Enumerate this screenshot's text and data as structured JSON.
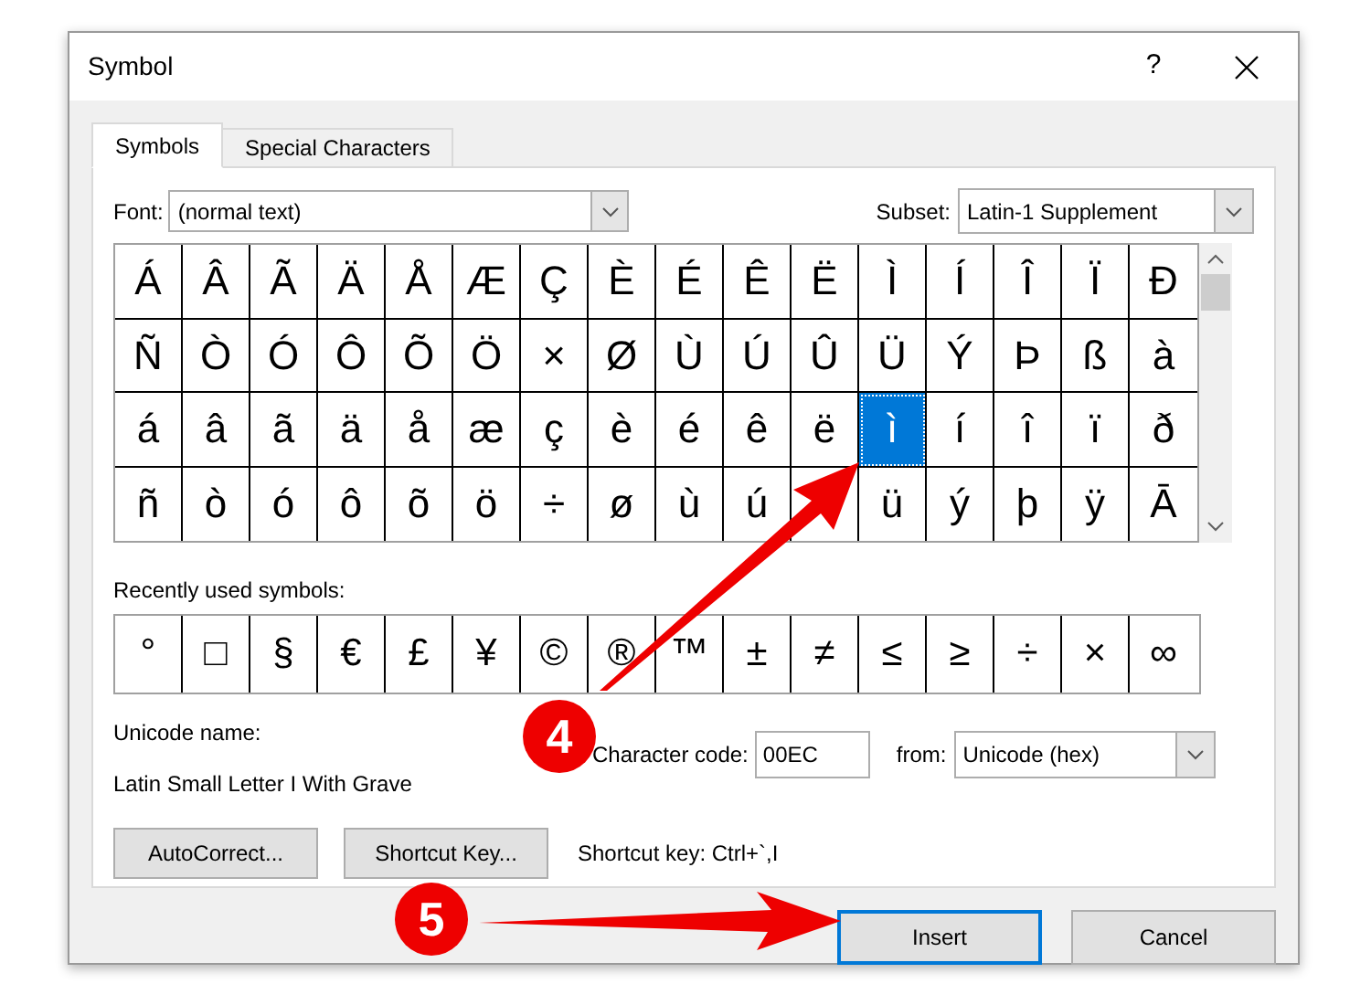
{
  "window": {
    "title": "Symbol",
    "help": "?"
  },
  "tabs": [
    {
      "label": "Symbols",
      "selected": true
    },
    {
      "label": "Special Characters",
      "selected": false
    }
  ],
  "font": {
    "label": "Font:",
    "value": "(normal text)"
  },
  "subset": {
    "label": "Subset:",
    "value": "Latin-1 Supplement"
  },
  "symbol_rows": [
    [
      {
        "char": "Á",
        "selected": false
      },
      {
        "char": "Â",
        "selected": false
      },
      {
        "char": "Ã",
        "selected": false
      },
      {
        "char": "Ä",
        "selected": false
      },
      {
        "char": "Å",
        "selected": false
      },
      {
        "char": "Æ",
        "selected": false
      },
      {
        "char": "Ç",
        "selected": false
      },
      {
        "char": "È",
        "selected": false
      },
      {
        "char": "É",
        "selected": false
      },
      {
        "char": "Ê",
        "selected": false
      },
      {
        "char": "Ë",
        "selected": false
      },
      {
        "char": "Ì",
        "selected": false
      },
      {
        "char": "Í",
        "selected": false
      },
      {
        "char": "Î",
        "selected": false
      },
      {
        "char": "Ï",
        "selected": false
      },
      {
        "char": "Ð",
        "selected": false
      }
    ],
    [
      {
        "char": "Ñ",
        "selected": false
      },
      {
        "char": "Ò",
        "selected": false
      },
      {
        "char": "Ó",
        "selected": false
      },
      {
        "char": "Ô",
        "selected": false
      },
      {
        "char": "Õ",
        "selected": false
      },
      {
        "char": "Ö",
        "selected": false
      },
      {
        "char": "×",
        "selected": false
      },
      {
        "char": "Ø",
        "selected": false
      },
      {
        "char": "Ù",
        "selected": false
      },
      {
        "char": "Ú",
        "selected": false
      },
      {
        "char": "Û",
        "selected": false
      },
      {
        "char": "Ü",
        "selected": false
      },
      {
        "char": "Ý",
        "selected": false
      },
      {
        "char": "Þ",
        "selected": false
      },
      {
        "char": "ß",
        "selected": false
      },
      {
        "char": "à",
        "selected": false
      }
    ],
    [
      {
        "char": "á",
        "selected": false
      },
      {
        "char": "â",
        "selected": false
      },
      {
        "char": "ã",
        "selected": false
      },
      {
        "char": "ä",
        "selected": false
      },
      {
        "char": "å",
        "selected": false
      },
      {
        "char": "æ",
        "selected": false
      },
      {
        "char": "ç",
        "selected": false
      },
      {
        "char": "è",
        "selected": false
      },
      {
        "char": "é",
        "selected": false
      },
      {
        "char": "ê",
        "selected": false
      },
      {
        "char": "ë",
        "selected": false
      },
      {
        "char": "ì",
        "selected": true
      },
      {
        "char": "í",
        "selected": false
      },
      {
        "char": "î",
        "selected": false
      },
      {
        "char": "ï",
        "selected": false
      },
      {
        "char": "ð",
        "selected": false
      }
    ],
    [
      {
        "char": "ñ",
        "selected": false
      },
      {
        "char": "ò",
        "selected": false
      },
      {
        "char": "ó",
        "selected": false
      },
      {
        "char": "ô",
        "selected": false
      },
      {
        "char": "õ",
        "selected": false
      },
      {
        "char": "ö",
        "selected": false
      },
      {
        "char": "÷",
        "selected": false
      },
      {
        "char": "ø",
        "selected": false
      },
      {
        "char": "ù",
        "selected": false
      },
      {
        "char": "ú",
        "selected": false
      },
      {
        "selected": false
      },
      {
        "char": "ü",
        "selected": false
      },
      {
        "char": "ý",
        "selected": false
      },
      {
        "char": "þ",
        "selected": false
      },
      {
        "char": "ÿ",
        "selected": false
      },
      {
        "char": "Ā",
        "selected": false
      }
    ]
  ],
  "recent": {
    "label": "Recently used symbols:",
    "symbols": [
      "°",
      "□",
      "§",
      "€",
      "£",
      "¥",
      "©",
      "®",
      "™",
      "±",
      "≠",
      "≤",
      "≥",
      "÷",
      "×",
      "∞"
    ]
  },
  "unicode_name": {
    "label": "Unicode name:",
    "value": "Latin Small Letter I With Grave"
  },
  "character_code": {
    "label": "Character code:",
    "value": "00EC"
  },
  "from": {
    "label": "from:",
    "value": "Unicode (hex)"
  },
  "buttons": [
    {
      "label": "AutoCorrect..."
    },
    {
      "label": "Shortcut Key..."
    }
  ],
  "shortcut_text": "Shortcut key: Ctrl+`,I",
  "footer_buttons": [
    {
      "label": "Insert",
      "default": true
    },
    {
      "label": "Cancel",
      "default": false
    }
  ],
  "callouts": [
    {
      "label": "4"
    },
    {
      "label": "5"
    }
  ]
}
